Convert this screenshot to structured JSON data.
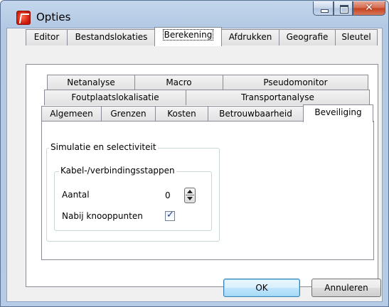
{
  "window": {
    "title": "Opties"
  },
  "top_tabs": [
    "Editor",
    "Bestandslokaties",
    "Berekening",
    "Afdrukken",
    "Geografie",
    "Sleutel"
  ],
  "active_top_tab": "Berekening",
  "inner_tabs": {
    "row1": [
      "Netanalyse",
      "Macro",
      "Pseudomonitor"
    ],
    "row2": [
      "Foutplaatslokalisatie",
      "Transportanalyse"
    ],
    "row3": [
      "Algemeen",
      "Grenzen",
      "Kosten",
      "Betrouwbaarheid",
      "Beveiliging"
    ]
  },
  "active_inner_tab": "Beveiliging",
  "group_outer": {
    "label": "Simulatie en selectiviteit"
  },
  "group_inner": {
    "label": "Kabel-/verbindingsstappen"
  },
  "fields": {
    "aantal_label": "Aantal",
    "aantal_value": "0",
    "nabij_label": "Nabij knooppunten",
    "nabij_checked": "✓"
  },
  "buttons": {
    "ok": "OK",
    "cancel": "Annuleren"
  }
}
